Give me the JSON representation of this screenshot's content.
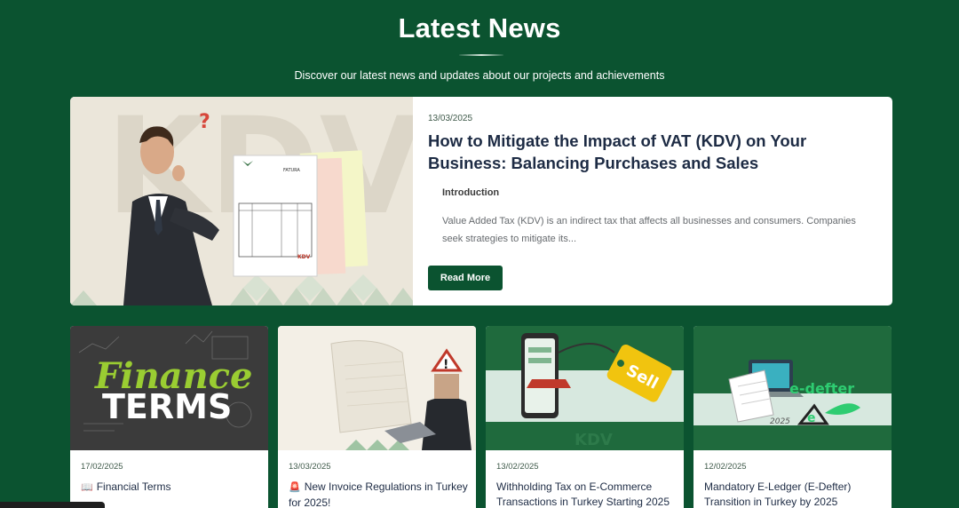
{
  "header": {
    "title": "Latest News",
    "subtitle": "Discover our latest news and updates about our projects and achievements"
  },
  "featured": {
    "date": "13/03/2025",
    "title": "How to Mitigate the Impact of VAT (KDV) on Your Business: Balancing Purchases and Sales",
    "intro_label": "Introduction",
    "excerpt": "Value Added Tax (KDV) is an indirect tax that affects all businesses and consumers. Companies seek strategies to mitigate its...",
    "button_label": "Read More",
    "image": {
      "invoice_header": "FATURA",
      "invoice_badge": "KDV",
      "question_mark": "?",
      "watermark": "KDV"
    }
  },
  "cards": [
    {
      "date": "17/02/2025",
      "emoji": "📖",
      "title": "Financial Terms",
      "image": {
        "line1": "Finance",
        "line2": "TERMS"
      }
    },
    {
      "date": "13/03/2025",
      "emoji": "🚨",
      "title": "New Invoice Regulations in Turkey for 2025!",
      "image": {
        "warning": "!"
      }
    },
    {
      "date": "13/02/2025",
      "emoji": "",
      "title": "Withholding Tax on E-Commerce Transactions in Turkey Starting 2025",
      "image": {
        "tag": "Sell",
        "watermark": "KDV"
      }
    },
    {
      "date": "12/02/2025",
      "emoji": "",
      "title": "Mandatory E-Ledger (E-Defter) Transition in Turkey by 2025",
      "image": {
        "brand": "e-defter",
        "year": "2025",
        "badge": "e"
      }
    }
  ],
  "colors": {
    "brand_green": "#0b5330",
    "accent_lime": "#9acd32",
    "title_navy": "#1d2b44"
  }
}
